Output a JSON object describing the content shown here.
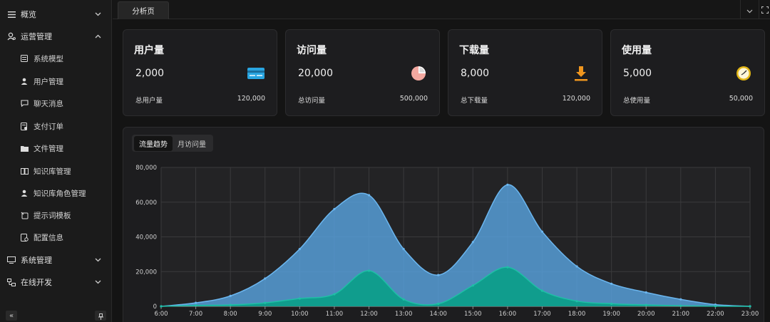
{
  "sidebar": {
    "top_items": [
      {
        "label": "概览",
        "icon": "menu-lines-icon",
        "chevron": "down"
      },
      {
        "label": "运营管理",
        "icon": "operations-icon",
        "chevron": "up"
      }
    ],
    "sub_items": [
      {
        "label": "系统模型",
        "icon": "list-icon"
      },
      {
        "label": "用户管理",
        "icon": "user-icon"
      },
      {
        "label": "聊天消息",
        "icon": "chat-icon"
      },
      {
        "label": "支付订单",
        "icon": "order-icon"
      },
      {
        "label": "文件管理",
        "icon": "folder-icon"
      },
      {
        "label": "知识库管理",
        "icon": "book-icon"
      },
      {
        "label": "知识库角色管理",
        "icon": "user-icon"
      },
      {
        "label": "提示词模板",
        "icon": "template-icon"
      },
      {
        "label": "配置信息",
        "icon": "config-icon"
      }
    ],
    "bottom_items": [
      {
        "label": "系统管理",
        "icon": "monitor-icon",
        "chevron": "down"
      },
      {
        "label": "在线开发",
        "icon": "dev-icon",
        "chevron": "down"
      }
    ],
    "collapse_icon": "«",
    "pin_icon": "pin-icon"
  },
  "tabbar": {
    "active_tab": "分析页"
  },
  "cards": [
    {
      "title": "用户量",
      "value": "2,000",
      "sub_label": "总用户量",
      "sub_value": "120,000",
      "icon": "card-icon"
    },
    {
      "title": "访问量",
      "value": "20,000",
      "sub_label": "总访问量",
      "sub_value": "500,000",
      "icon": "pie-chart-icon"
    },
    {
      "title": "下载量",
      "value": "8,000",
      "sub_label": "总下载量",
      "sub_value": "120,000",
      "icon": "download-icon"
    },
    {
      "title": "使用量",
      "value": "5,000",
      "sub_label": "总使用量",
      "sub_value": "50,000",
      "icon": "clock-icon"
    }
  ],
  "chart_tabs": [
    {
      "label": "流量趋势",
      "active": true
    },
    {
      "label": "月访问量",
      "active": false
    }
  ],
  "chart_data": {
    "type": "area",
    "x": [
      "6:00",
      "7:00",
      "8:00",
      "9:00",
      "10:00",
      "11:00",
      "12:00",
      "13:00",
      "14:00",
      "15:00",
      "16:00",
      "17:00",
      "18:00",
      "19:00",
      "20:00",
      "21:00",
      "22:00",
      "23:00"
    ],
    "ylim": [
      0,
      80000
    ],
    "yticks": [
      "0",
      "20,000",
      "40,000",
      "60,000",
      "80,000"
    ],
    "grid": true,
    "series": [
      {
        "values": [
          0,
          2000,
          6000,
          16000,
          33000,
          56000,
          64000,
          33000,
          18000,
          37000,
          70000,
          43000,
          23000,
          13000,
          8000,
          4000,
          1000,
          0
        ],
        "color": "#4a90c8"
      },
      {
        "values": [
          0,
          500,
          800,
          2000,
          4500,
          7000,
          20500,
          4000,
          1500,
          12000,
          22500,
          9000,
          3000,
          1500,
          800,
          300,
          100,
          0
        ],
        "color": "#0d9e8a"
      }
    ]
  }
}
